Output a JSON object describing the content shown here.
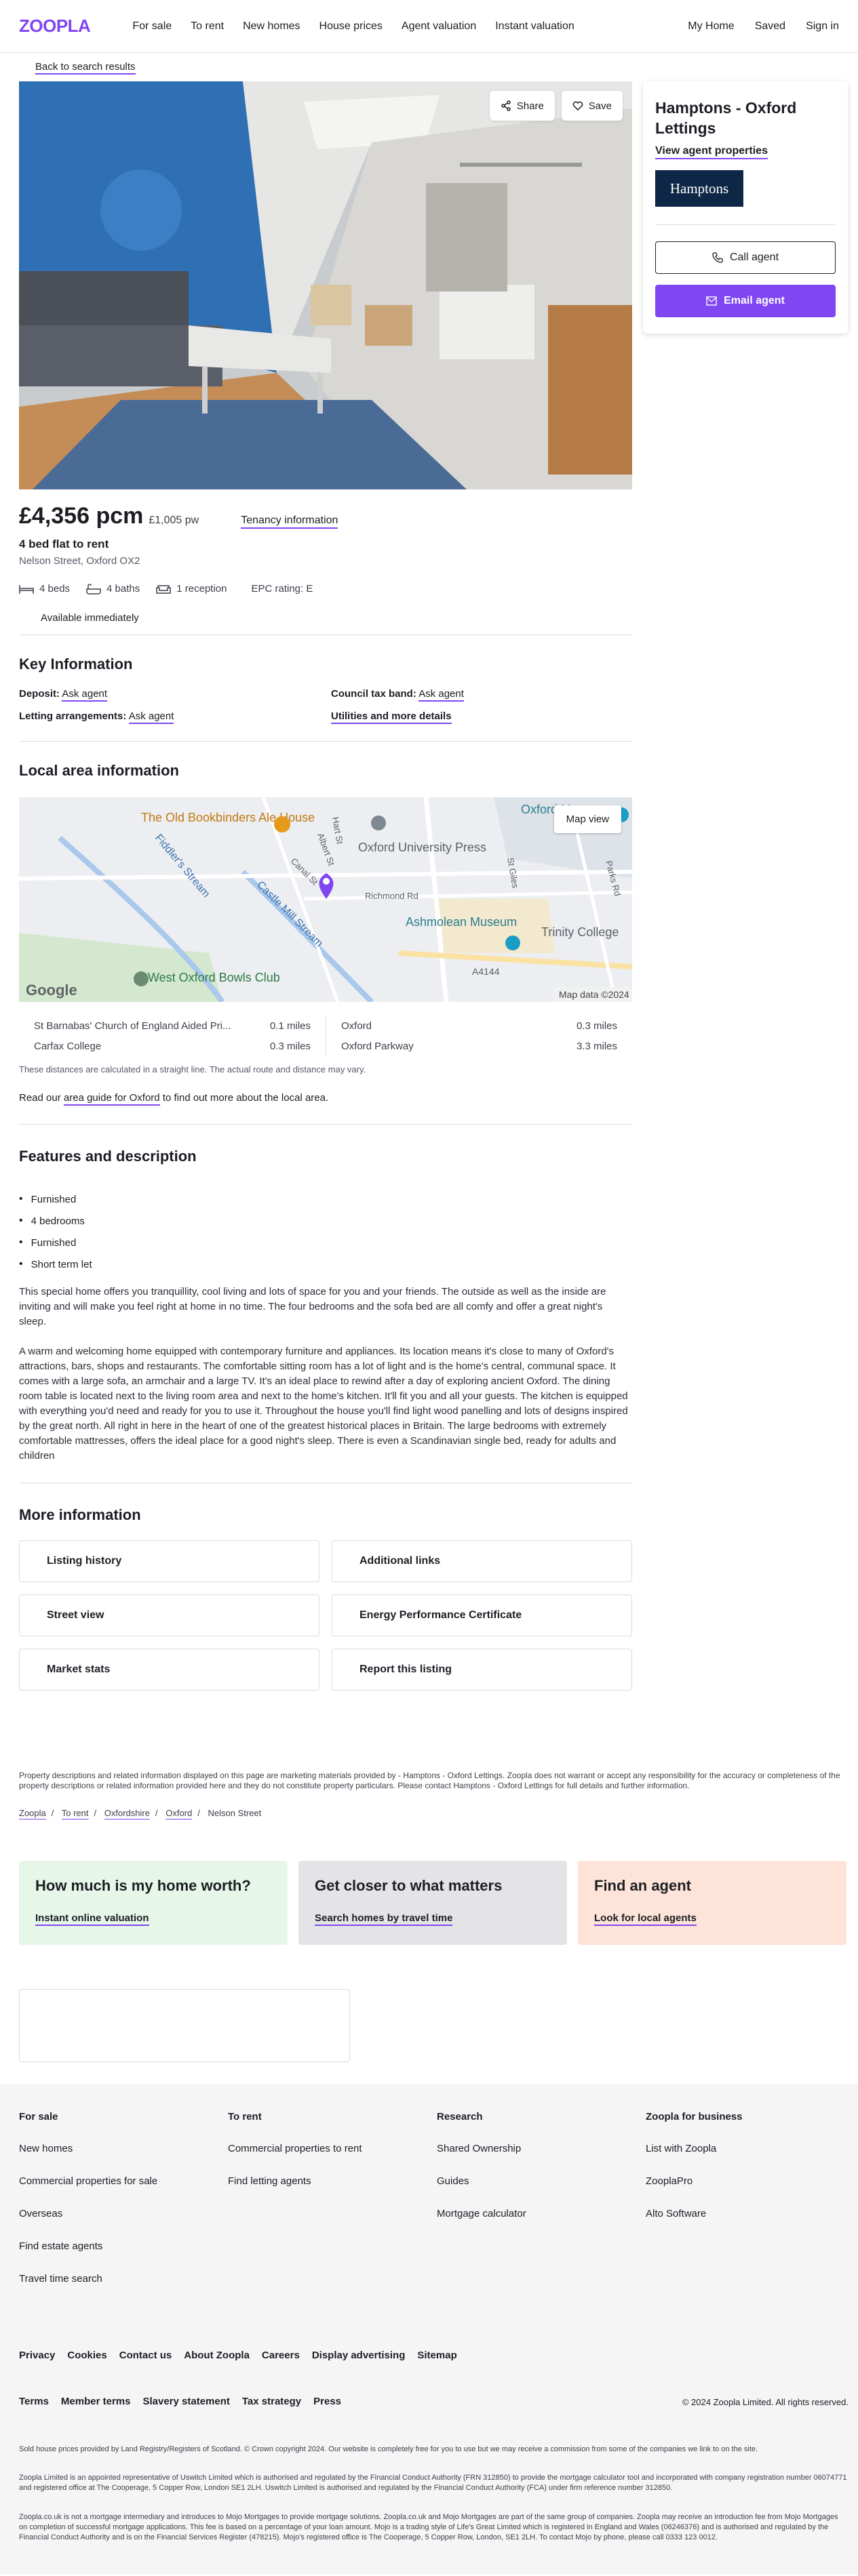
{
  "header": {
    "logo": "ZOOPLA",
    "nav": [
      "For sale",
      "To rent",
      "New homes",
      "House prices",
      "Agent valuation",
      "Instant valuation"
    ],
    "user_nav": [
      "My Home",
      "Saved",
      "Sign in"
    ]
  },
  "back_link": "Back to search results",
  "hero": {
    "share": "Share",
    "save": "Save"
  },
  "listing": {
    "price": "£4,356 pcm",
    "price_pw": "£1,005 pw",
    "tenancy": "Tenancy information",
    "title": "4 bed flat to rent",
    "address": "Nelson Street, Oxford OX2",
    "beds": "4 beds",
    "baths": "4 baths",
    "reception": "1 reception",
    "epc": "EPC rating: E",
    "available": "Available immediately"
  },
  "key_info": {
    "heading": "Key Information",
    "deposit_label": "Deposit:",
    "deposit_value": "Ask agent",
    "council_label": "Council tax band:",
    "council_value": "Ask agent",
    "letting_label": "Letting arrangements:",
    "letting_value": "Ask agent",
    "utilities": "Utilities and more details"
  },
  "local_area": {
    "heading": "Local area information",
    "map_view": "Map view",
    "map_labels": {
      "pub": "The Old Bookbinders Ale House",
      "museum": "Oxford Museum",
      "press": "Oxford University Press",
      "fiddlers": "Fiddler's Stream",
      "castle_mill": "Castle Mill Stream",
      "richmond": "Richmond Rd",
      "ashmolean": "Ashmolean Museum",
      "trinity": "Trinity College",
      "bowls": "West Oxford Bowls Club",
      "a4144": "A4144",
      "hart_st": "Hart St",
      "albert_st": "Albert St",
      "canal_st": "Canal St",
      "st_giles": "St Giles",
      "parks_rd": "Parks Rd",
      "google": "Google",
      "map_data": "Map data ©2024"
    },
    "distances_left": [
      {
        "name": "St Barnabas' Church of England Aided Pri...",
        "dist": "0.1 miles"
      },
      {
        "name": "Carfax College",
        "dist": "0.3 miles"
      }
    ],
    "distances_right": [
      {
        "name": "Oxford",
        "dist": "0.3 miles"
      },
      {
        "name": "Oxford Parkway",
        "dist": "3.3 miles"
      }
    ],
    "note": "These distances are calculated in a straight line. The actual route and distance may vary.",
    "guide_prefix": "Read our",
    "guide_link": "area guide for Oxford",
    "guide_suffix": "to find out more about the local area."
  },
  "features": {
    "heading": "Features and description",
    "items": [
      "Furnished",
      "4 bedrooms",
      "Furnished",
      "Short term let"
    ],
    "para1": "This special home offers you tranquillity, cool living and lots of space for you and your friends. The outside as well as the inside are inviting and will make you feel right at home in no time. The four bedrooms and the sofa bed are all comfy and offer a great night's sleep.",
    "para2": "A warm and welcoming home equipped with contemporary furniture and appliances. Its location means it's close to many of Oxford's attractions, bars, shops and restaurants. The comfortable sitting room has a lot of light and is the home's central, communal space. It comes with a large sofa, an armchair and a large TV. It's an ideal place to rewind after a day of exploring ancient Oxford. The dining room table is located next to the living room area and next to the home's kitchen. It'll fit you and all your guests. The kitchen is equipped with everything you'd need and ready for you to use it. Throughout the house you'll find light wood panelling and lots of designs inspired by the great north. All right in here in the heart of one of the greatest historical places in Britain. The large bedrooms with extremely comfortable mattresses, offers the ideal place for a good night's sleep. There is even a Scandinavian single bed, ready for adults and children"
  },
  "more_info": {
    "heading": "More information",
    "items": [
      "Listing history",
      "Additional links",
      "Street view",
      "Energy Performance Certificate",
      "Market stats",
      "Report this listing"
    ]
  },
  "agent": {
    "name": "Hamptons - Oxford Lettings",
    "view_properties": "View agent properties",
    "logo_text": "Hamptons",
    "call": "Call agent",
    "email": "Email agent"
  },
  "disclaimer": "Property descriptions and related information displayed on this page are marketing materials provided by - Hamptons - Oxford Lettings. Zoopla does not warrant or accept any responsibility for the accuracy or completeness of the property descriptions or related information provided here and they do not constitute property particulars. Please contact Hamptons - Oxford Lettings for full details and further information.",
  "breadcrumbs": [
    "Zoopla",
    "To rent",
    "Oxfordshire",
    "Oxford",
    "Nelson Street"
  ],
  "promos": [
    {
      "title": "How much is my home worth?",
      "link": "Instant online valuation",
      "bg": "#e6f6e8"
    },
    {
      "title": "Get closer to what matters",
      "link": "Search homes by travel time",
      "bg": "#e4e4e6"
    },
    {
      "title": "Find an agent",
      "link": "Look for local agents",
      "bg": "#fde3d8"
    }
  ],
  "footer": {
    "columns": [
      {
        "title": "For sale",
        "items": [
          "New homes",
          "Commercial properties for sale",
          "Overseas",
          "Find estate agents",
          "Travel time search"
        ]
      },
      {
        "title": "To rent",
        "items": [
          "Commercial properties to rent",
          "Find letting agents"
        ]
      },
      {
        "title": "Research",
        "items": [
          "Shared Ownership",
          "Guides",
          "Mortgage calculator"
        ]
      },
      {
        "title": "Zoopla for business",
        "items": [
          "List with Zoopla",
          "ZooplaPro",
          "Alto Software"
        ]
      }
    ],
    "links_row1": [
      "Privacy",
      "Cookies",
      "Contact us",
      "About Zoopla",
      "Careers",
      "Display advertising",
      "Sitemap"
    ],
    "links_row2": [
      "Terms",
      "Member terms",
      "Slavery statement",
      "Tax strategy",
      "Press"
    ],
    "copyright": "© 2024 Zoopla Limited. All rights reserved.",
    "legal1": "Sold house prices provided by Land Registry/Registers of Scotland. © Crown copyright 2024. Our website is completely free for you to use but we may receive a commission from some of the companies we link to on the site.",
    "legal2": "Zoopla Limited is an appointed representative of Uswitch Limited which is authorised and regulated by the Financial Conduct Authority (FRN 312850) to provide the mortgage calculator tool and incorporated with company registration number 06074771 and registered office at The Cooperage, 5 Copper Row, London SE1 2LH. Uswitch Limited is authorised and regulated by the Financial Conduct Authority (FCA) under firm reference number 312850.",
    "legal3": "Zoopla.co.uk is not a mortgage intermediary and introduces to Mojo Mortgages to provide mortgage solutions. Zoopla.co.uk and Mojo Mortgages are part of the same group of companies. Zoopla may receive an introduction fee from Mojo Mortgages on completion of successful mortgage applications. This fee is based on a percentage of your loan amount. Mojo is a trading style of Life's Great Limited which is registered in England and Wales (06246376) and is authorised and regulated by the Financial Conduct Authority and is on the Financial Services Register (478215). Mojo's registered office is The Cooperage, 5 Copper Row, London, SE1 2LH. To contact Mojo by phone, please call 0333 123 0012."
  },
  "colors": {
    "brand": "#8046f1",
    "text": "#1c1e24",
    "footer_bg": "#f5f5f6"
  }
}
